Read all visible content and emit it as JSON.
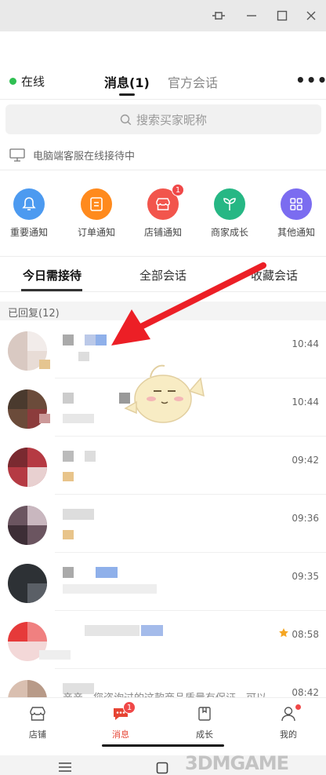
{
  "window": {
    "controls": [
      "pin-icon",
      "minimize-icon",
      "maximize-icon",
      "close-icon"
    ]
  },
  "header": {
    "status": "在线",
    "status_color": "#2fbf52",
    "tab_messages": "消息(1)",
    "tab_official": "官方会话",
    "more": "•••"
  },
  "search": {
    "placeholder": "搜索买家昵称"
  },
  "pc_banner": {
    "text": "电脑端客服在线接待中"
  },
  "notifications": [
    {
      "label": "重要通知",
      "icon": "bell-icon",
      "color": "#4c9af0"
    },
    {
      "label": "订单通知",
      "icon": "order-icon",
      "color": "#ff8a1d"
    },
    {
      "label": "店铺通知",
      "icon": "store-icon",
      "color": "#f2554c",
      "badge": "1"
    },
    {
      "label": "商家成长",
      "icon": "sprout-icon",
      "color": "#26b784"
    },
    {
      "label": "其他通知",
      "icon": "grid-icon",
      "color": "#7b6cf0"
    }
  ],
  "session_tabs": [
    "今日需接待",
    "全部会话",
    "收藏会话"
  ],
  "replied_label": "已回复(12)",
  "chats": [
    {
      "time": "10:44",
      "starred": false
    },
    {
      "time": "10:44",
      "starred": false
    },
    {
      "time": "09:42",
      "starred": false
    },
    {
      "time": "09:36",
      "starred": false
    },
    {
      "time": "09:35",
      "starred": false
    },
    {
      "time": "08:58",
      "starred": true
    },
    {
      "time": "08:42",
      "starred": false
    }
  ],
  "partial_preview": "亲亲，您咨询过的这款商品质量有保证，可以",
  "bottom_nav": [
    {
      "label": "店铺",
      "icon": "store-icon"
    },
    {
      "label": "消息",
      "icon": "chat-icon",
      "badge": "1",
      "active": true
    },
    {
      "label": "成长",
      "icon": "growth-icon"
    },
    {
      "label": "我的",
      "icon": "person-icon",
      "dot": true
    }
  ],
  "accent_color": "#e64433",
  "watermark": "3DMGAME"
}
